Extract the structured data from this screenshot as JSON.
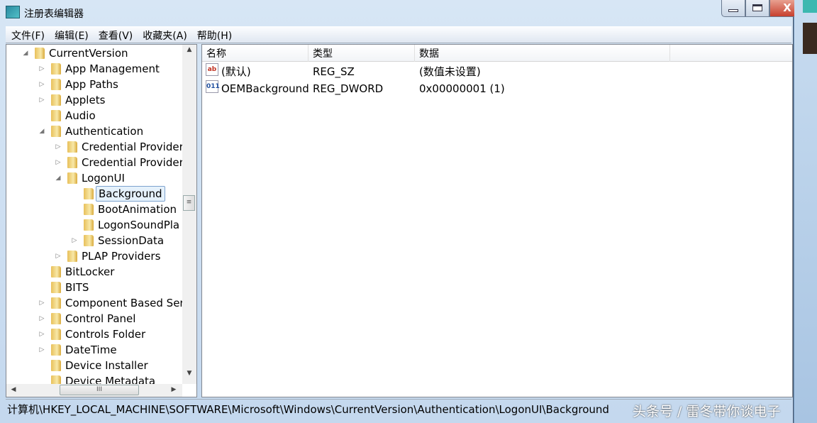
{
  "window": {
    "title": "注册表编辑器",
    "close_label": "X"
  },
  "menu": [
    "文件(F)",
    "编辑(E)",
    "查看(V)",
    "收藏夹(A)",
    "帮助(H)"
  ],
  "tree": [
    {
      "label": "CurrentVersion",
      "depth": 0,
      "expander": "expanded"
    },
    {
      "label": "App Management",
      "depth": 1,
      "expander": "collapsed"
    },
    {
      "label": "App Paths",
      "depth": 1,
      "expander": "collapsed"
    },
    {
      "label": "Applets",
      "depth": 1,
      "expander": "collapsed"
    },
    {
      "label": "Audio",
      "depth": 1,
      "expander": "none"
    },
    {
      "label": "Authentication",
      "depth": 1,
      "expander": "expanded"
    },
    {
      "label": "Credential Provider",
      "depth": 2,
      "expander": "collapsed"
    },
    {
      "label": "Credential Provider",
      "depth": 2,
      "expander": "collapsed"
    },
    {
      "label": "LogonUI",
      "depth": 2,
      "expander": "expanded"
    },
    {
      "label": "Background",
      "depth": 3,
      "expander": "none",
      "selected": true
    },
    {
      "label": "BootAnimation",
      "depth": 3,
      "expander": "none"
    },
    {
      "label": "LogonSoundPla",
      "depth": 3,
      "expander": "none"
    },
    {
      "label": "SessionData",
      "depth": 3,
      "expander": "collapsed"
    },
    {
      "label": "PLAP Providers",
      "depth": 2,
      "expander": "collapsed"
    },
    {
      "label": "BitLocker",
      "depth": 1,
      "expander": "none"
    },
    {
      "label": "BITS",
      "depth": 1,
      "expander": "none"
    },
    {
      "label": "Component Based Ser",
      "depth": 1,
      "expander": "collapsed"
    },
    {
      "label": "Control Panel",
      "depth": 1,
      "expander": "collapsed"
    },
    {
      "label": "Controls Folder",
      "depth": 1,
      "expander": "collapsed"
    },
    {
      "label": "DateTime",
      "depth": 1,
      "expander": "collapsed"
    },
    {
      "label": "Device Installer",
      "depth": 1,
      "expander": "none"
    },
    {
      "label": "Device Metadata",
      "depth": 1,
      "expander": "none"
    }
  ],
  "list": {
    "columns": [
      "名称",
      "类型",
      "数据"
    ],
    "rows": [
      {
        "name": "(默认)",
        "type": "REG_SZ",
        "data": "(数值未设置)",
        "icon": "string-value-icon",
        "icon_text": "ab"
      },
      {
        "name": "OEMBackground",
        "type": "REG_DWORD",
        "data": "0x00000001 (1)",
        "icon": "binary-value-icon",
        "icon_text": "011"
      }
    ]
  },
  "status": {
    "path": "计算机\\HKEY_LOCAL_MACHINE\\SOFTWARE\\Microsoft\\Windows\\CurrentVersion\\Authentication\\LogonUI\\Background"
  },
  "watermark": "头条号 / 雷冬带你谈电子"
}
